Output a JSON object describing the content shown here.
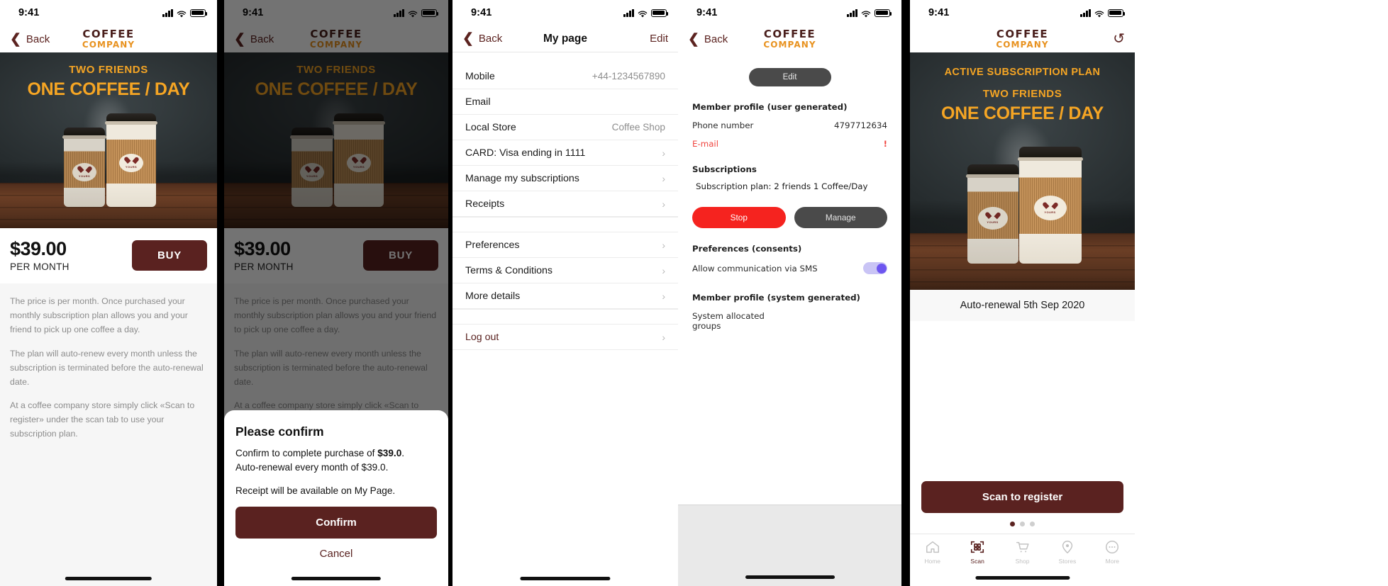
{
  "common": {
    "status_time": "9:41",
    "brand_line1": "COFFEE",
    "brand_line2": "COMPANY",
    "back_label": "Back",
    "chevron": "❮",
    "chevron_right": "›"
  },
  "colors": {
    "brand_dark": "#5a2220",
    "brand_orange": "#f5a524",
    "danger": "#f5231f",
    "toggle_on": "#6d56f0"
  },
  "screen1": {
    "name": "offer-detail",
    "hero": {
      "small": "TWO FRIENDS",
      "big": "ONE COFFEE / DAY"
    },
    "price": {
      "amount": "$39.00",
      "period": "PER MONTH",
      "buy_label": "BUY"
    },
    "info_paragraphs": [
      "The price is per month. Once purchased your monthly subscription plan allows you and your friend to pick up one coffee a day.",
      "The plan will auto-renew every month unless the subscription is terminated before the auto-renewal date.",
      "At a coffee company store simply click «Scan to register» under the scan tab to use your subscription plan."
    ]
  },
  "screen2": {
    "name": "confirm-purchase",
    "hero": {
      "small": "TWO FRIENDS",
      "big": "ONE COFFEE / DAY"
    },
    "price": {
      "amount": "$39.00",
      "period": "PER MONTH",
      "buy_label": "BUY"
    },
    "info_paragraphs": [
      "The price is per month. Once purchased your monthly subscription plan allows you and your friend to pick up one coffee a day.",
      "The plan will auto-renew every month unless the subscription is terminated before the auto-renewal date.",
      "At a coffee company store simply click «Scan to register» under the scan tab to use your subscription plan."
    ],
    "sheet": {
      "title": "Please confirm",
      "line1_prefix": "Confirm to complete purchase of ",
      "line1_amount": "$39.0",
      "line1_suffix": ".",
      "line2": "Auto-renewal every month of $39.0.",
      "line3": "Receipt will be available on My Page.",
      "confirm_label": "Confirm",
      "cancel_label": "Cancel"
    }
  },
  "screen3": {
    "name": "my-page",
    "title": "My page",
    "edit_label": "Edit",
    "rows_group1": [
      {
        "label": "Mobile",
        "value": "+44-1234567890",
        "chevron": false
      },
      {
        "label": "Email",
        "value": "",
        "chevron": false
      },
      {
        "label": "Local Store",
        "value": "Coffee Shop",
        "chevron": false
      },
      {
        "label": "CARD: Visa ending in 1111",
        "value": "",
        "chevron": true
      },
      {
        "label": "Manage my subscriptions",
        "value": "",
        "chevron": true
      },
      {
        "label": "Receipts",
        "value": "",
        "chevron": true
      }
    ],
    "rows_group2": [
      {
        "label": "Preferences",
        "value": "",
        "chevron": true
      },
      {
        "label": "Terms & Conditions",
        "value": "",
        "chevron": true
      },
      {
        "label": "More details",
        "value": "",
        "chevron": true
      }
    ],
    "rows_group3": [
      {
        "label": "Log out",
        "value": "",
        "chevron": true
      }
    ]
  },
  "screen4": {
    "name": "member-profile",
    "edit_label": "Edit",
    "section_user": "Member profile (user generated)",
    "phone_label": "Phone number",
    "phone_value": "4797712634",
    "email_label": "E-mail",
    "email_alert": "!",
    "subscriptions_label": "Subscriptions",
    "subscription_plan": "Subscription plan: 2 friends 1 Coffee/Day",
    "stop_label": "Stop",
    "manage_label": "Manage",
    "preferences_label": "Preferences (consents)",
    "sms_label": "Allow communication via SMS",
    "sms_enabled": true,
    "section_system": "Member profile (system generated)",
    "system_groups_line1": "System allocated",
    "system_groups_line2": "groups"
  },
  "screen5": {
    "name": "active-subscription",
    "refresh_icon": "↺",
    "hero": {
      "banner": "ACTIVE SUBSCRIPTION PLAN",
      "small": "TWO FRIENDS",
      "big": "ONE COFFEE / DAY"
    },
    "renewal_text": "Auto-renewal 5th Sep 2020",
    "scan_label": "Scan to register",
    "page_dots": {
      "count": 3,
      "active_index": 0
    },
    "tabs": [
      {
        "label": "Home",
        "icon": "home-icon",
        "active": false
      },
      {
        "label": "Scan",
        "icon": "qr-scan-icon",
        "active": true
      },
      {
        "label": "Shop",
        "icon": "cart-icon",
        "active": false
      },
      {
        "label": "Stores",
        "icon": "map-pin-icon",
        "active": false
      },
      {
        "label": "More",
        "icon": "more-dots-icon",
        "active": false
      }
    ]
  }
}
